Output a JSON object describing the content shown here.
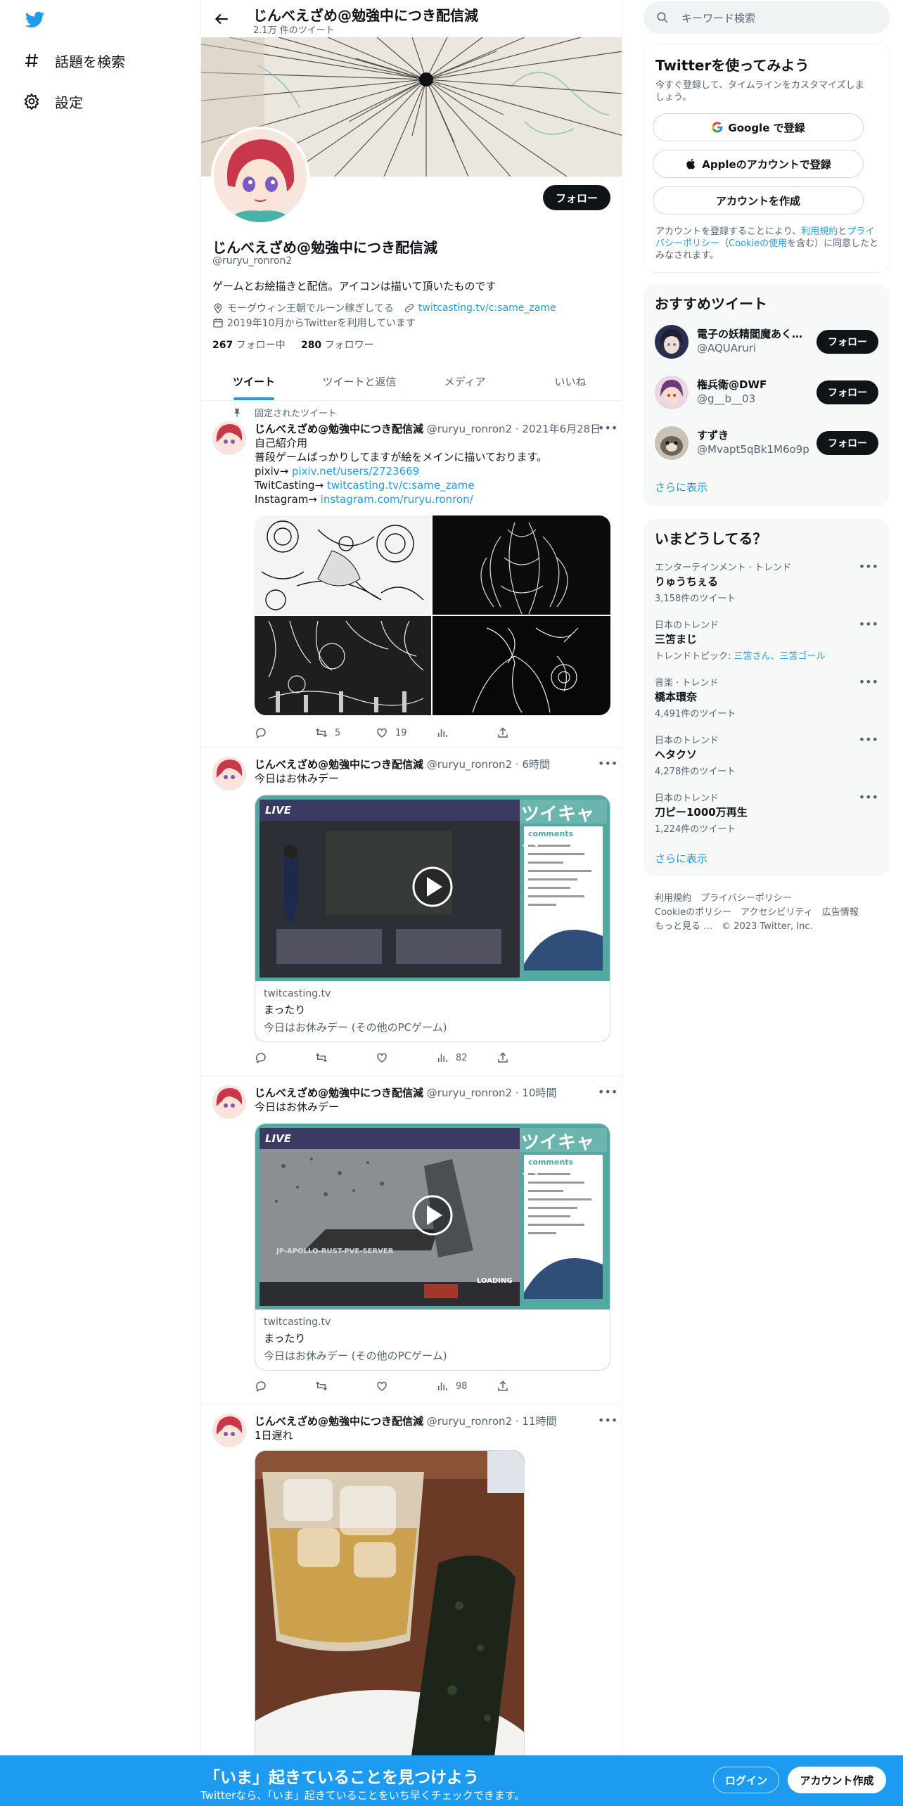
{
  "nav": {
    "explore": "話題を検索",
    "settings": "設定"
  },
  "header": {
    "title": "じんべえざめ@勉強中につき配信減",
    "tweet_count": "2.1万 件のツイート"
  },
  "profile": {
    "follow": "フォロー",
    "name": "じんべえざめ@勉強中につき配信減",
    "handle": "@ruryu_ronron2",
    "bio": "ゲームとお絵描きと配信。アイコンは描いて頂いたものです",
    "location": "モーグウィン王朝でルーン稼ぎしてる",
    "link": "twitcasting.tv/c:same_zame",
    "joined": "2019年10月からTwitterを利用しています",
    "following_count": "267",
    "following_label": "フォロー中",
    "followers_count": "280",
    "followers_label": "フォロワー"
  },
  "tabs": [
    "ツイート",
    "ツイートと返信",
    "メディア",
    "いいね"
  ],
  "tweets": [
    {
      "pinned_label": "固定されたツイート",
      "name": "じんべえざめ@勉強中につき配信減",
      "meta": "@ruryu_ronron2 · 2021年6月28日",
      "line1": "自己紹介用",
      "line2": "普段ゲームばっかりしてますが絵をメインに描いております。",
      "line3_prefix": "pixiv→ ",
      "line3_link": "pixiv.net/users/2723669",
      "line4_prefix": "TwitCasting→ ",
      "line4_link": "twitcasting.tv/c:same_zame",
      "line5_prefix": "Instagram→ ",
      "line5_link": "instagram.com/ruryu.ronron/",
      "retweets": "5",
      "likes": "19"
    },
    {
      "name": "じんべえざめ@勉強中につき配信減",
      "meta": "@ruryu_ronron2 · 6時間",
      "text": "今日はお休みデー",
      "card_domain": "twitcasting.tv",
      "card_title": "まったり",
      "card_desc": "今日はお休みデー (その他のPCゲーム)",
      "overlay_live": "LIVE",
      "overlay_brand": "ツイキャス",
      "overlay_comments": "comments",
      "views": "82"
    },
    {
      "name": "じんべえざめ@勉強中につき配信減",
      "meta": "@ruryu_ronron2 · 10時間",
      "text": "今日はお休みデー",
      "card_domain": "twitcasting.tv",
      "card_title": "まったり",
      "card_desc": "今日はお休みデー (その他のPCゲーム)",
      "overlay_live": "LIVE",
      "overlay_brand": "ツイキャス",
      "overlay_comments": "comments",
      "overlay_server": "JP-APOLLO-RUST-PVE-SERVER",
      "overlay_loading": "LOADING",
      "views": "98"
    },
    {
      "name": "じんべえざめ@勉強中につき配信減",
      "meta": "@ruryu_ronron2 · 11時間",
      "text": "1日遅れ"
    }
  ],
  "right": {
    "search_placeholder": "キーワード検索",
    "signup_title": "Twitterを使ってみよう",
    "signup_desc_1": "今すぐ登録して、タイムラインをカスタマイズしま",
    "signup_desc_2": "しょう。",
    "google_btn": "Google で登録",
    "apple_btn": "Appleのアカウントで登録",
    "create_btn": "アカウントを作成",
    "terms_1a": "アカウントを登録することにより、",
    "terms_1b": "利用規約",
    "terms_1c": "と",
    "terms_1d": "プライ",
    "terms_2a": "バシーポリシー",
    "terms_2b": "（",
    "terms_2c": "Cookieの使用",
    "terms_2d": "を含む）に同意したと",
    "terms_3": "みなされます。",
    "rec_title": "おすすめツイート",
    "recs": [
      {
        "name": "電子の妖精閻魔あく…",
        "handle": "@AQUAruri",
        "btn": "フォロー"
      },
      {
        "name": "権兵衛@DWF",
        "handle": "@g__b__03",
        "btn": "フォロー"
      },
      {
        "name": "すずき",
        "handle": "@Mvapt5qBk1M6o9p",
        "btn": "フォロー"
      }
    ],
    "show_more": "さらに表示",
    "trends_title": "いまどうしてる？",
    "trends": [
      {
        "cat": "エンターテインメント · トレンド",
        "name": "りゅうちぇる",
        "count": "3,158件のツイート"
      },
      {
        "cat": "日本のトレンド",
        "name": "三笘まじ",
        "topic_prefix": "トレンドトピック: ",
        "topic_link": "三笘さん、三笘ゴール"
      },
      {
        "cat": "音楽 · トレンド",
        "name": "橋本環奈",
        "count": "4,491件のツイート"
      },
      {
        "cat": "日本のトレンド",
        "name": "ヘタクソ",
        "count": "4,278件のツイート"
      },
      {
        "cat": "日本のトレンド",
        "name": "刀ピー1000万再生",
        "count": "1,224件のツイート"
      }
    ],
    "trends_more": "さらに表示",
    "footer_1": "利用規約　プライバシーポリシー",
    "footer_2": "Cookieのポリシー　アクセシビリティ　広告情報",
    "footer_3": "もっと見る …　© 2023 Twitter, Inc."
  },
  "bottom": {
    "title": "「いま」起きていることを見つけよう",
    "subtitle": "Twitterなら、「いま」起きていることをいち早くチェックできます。",
    "login": "ログイン",
    "signup": "アカウント作成"
  },
  "colors": {
    "accent": "#1d9bf0",
    "text": "#0f1419",
    "muted": "#536471"
  }
}
